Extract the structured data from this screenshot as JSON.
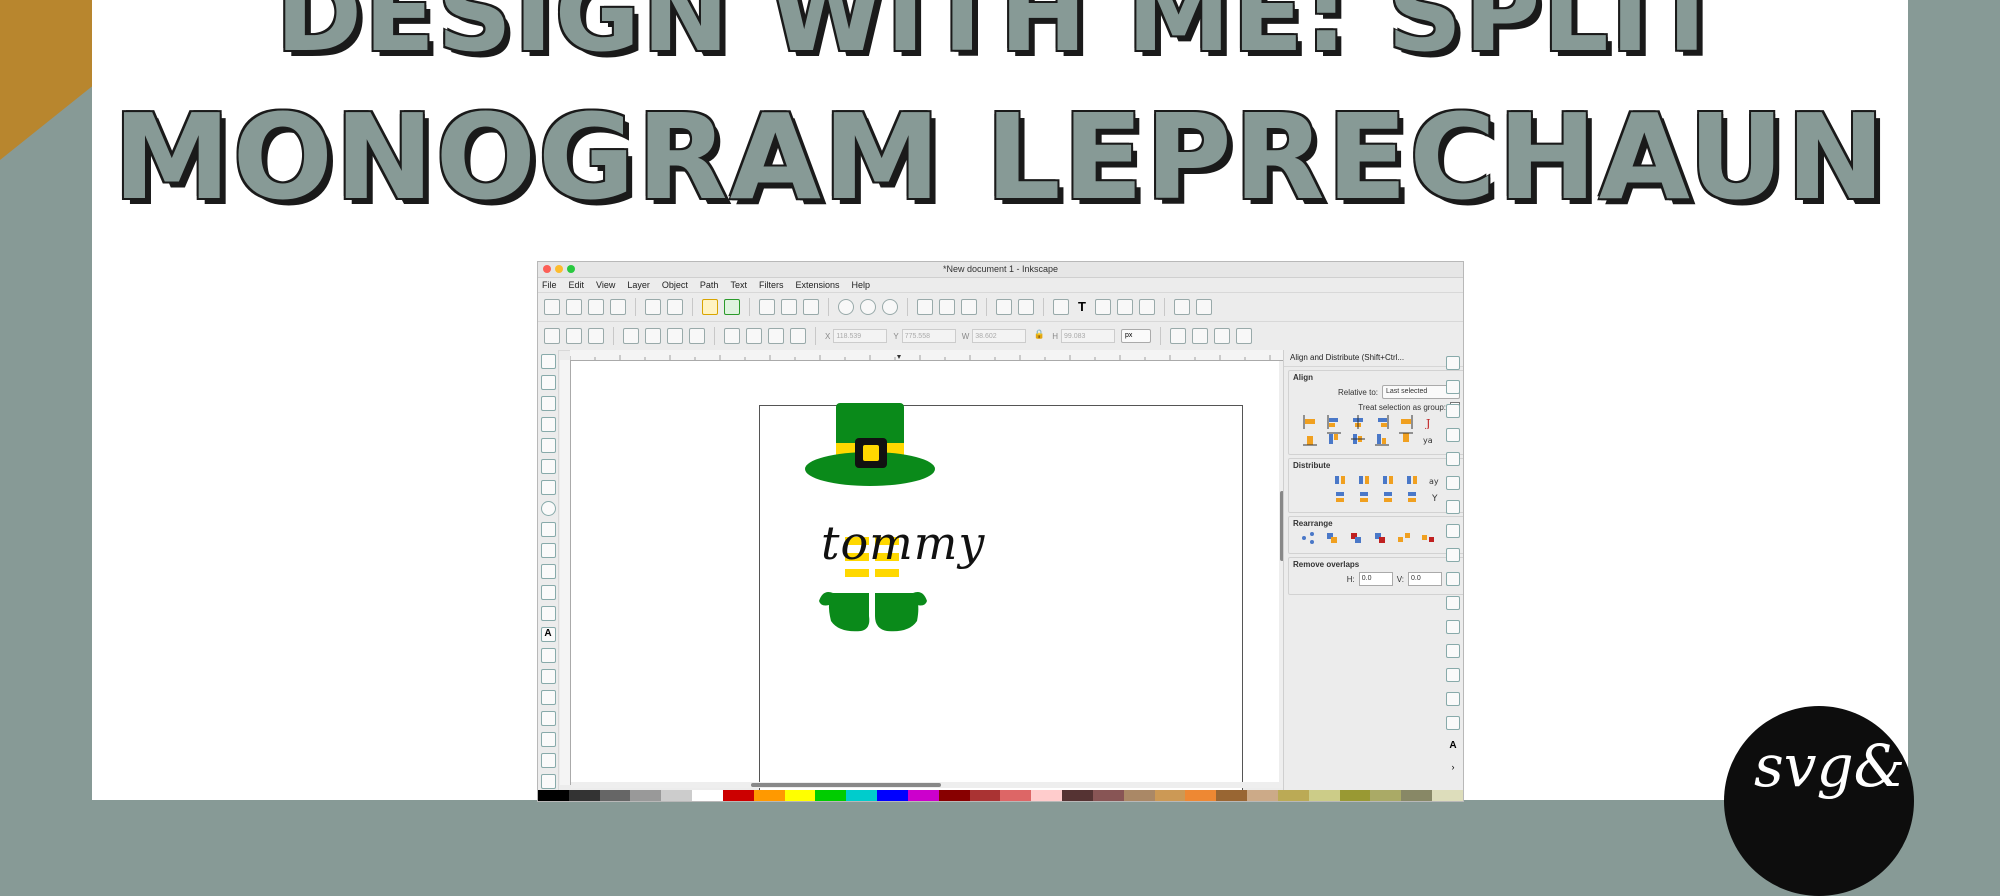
{
  "headline": {
    "line1": "DESIGN WITH ME: SPLIT",
    "line2": "MONOGRAM LEPRECHAUN"
  },
  "colors": {
    "background": "#879a96",
    "accent_gold": "#b8862e",
    "headline_fill": "#879a96",
    "leprechaun_green": "#0a8a1a",
    "leprechaun_yellow": "#ffd800"
  },
  "window": {
    "title": "*New document 1 - Inkscape",
    "menu": [
      "File",
      "Edit",
      "View",
      "Layer",
      "Object",
      "Path",
      "Text",
      "Filters",
      "Extensions",
      "Help"
    ]
  },
  "toolbar": {
    "x_label": "X",
    "x_value": "118.539",
    "y_label": "Y",
    "y_value": "775.558",
    "w_label": "W",
    "w_value": "38.602",
    "h_label": "H",
    "h_value": "99.083",
    "unit": "px"
  },
  "canvas": {
    "design_text": "tommy"
  },
  "align_panel": {
    "title": "Align and Distribute (Shift+Ctrl...",
    "align_label": "Align",
    "relative_to_label": "Relative to:",
    "relative_to_value": "Last selected",
    "treat_group_label": "Treat selection as group:",
    "distribute_label": "Distribute",
    "rearrange_label": "Rearrange",
    "remove_overlaps_label": "Remove overlaps",
    "h_label": "H:",
    "h_value": "0.0",
    "v_label": "V:",
    "v_value": "0.0"
  },
  "logo": {
    "icon": "svg-e-brand-logo"
  }
}
